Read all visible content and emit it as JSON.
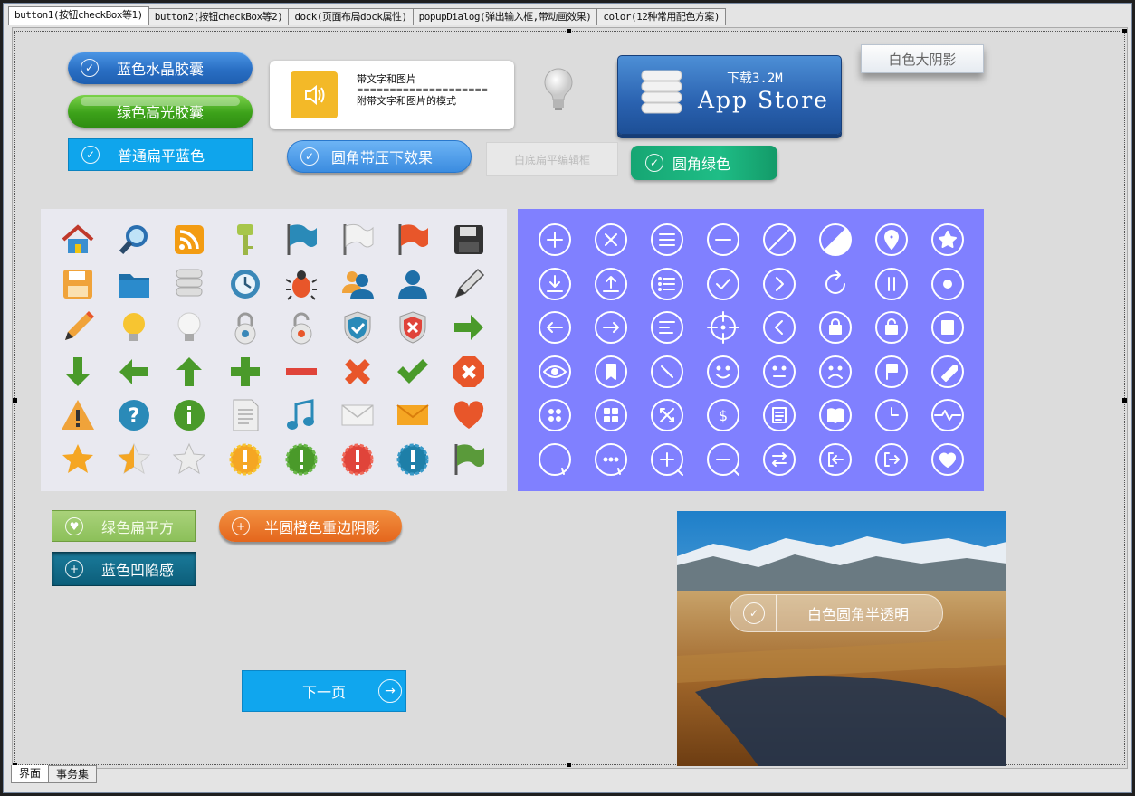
{
  "tabs": [
    {
      "label": "button1(按钮checkBox等1)"
    },
    {
      "label": "button2(按钮checkBox等2)"
    },
    {
      "label": "dock(页面布局dock属性)"
    },
    {
      "label": "popupDialog(弹出输入框,带动画效果)"
    },
    {
      "label": "color(12种常用配色方案)"
    }
  ],
  "buttons": {
    "blue_crystal": "蓝色水晶胶囊",
    "green_glow": "绿色高光胶囊",
    "flat_blue": "普通扁平蓝色",
    "press": "圆角带压下效果",
    "white_edit": "白底扁平编辑框",
    "round_green": "圆角绿色",
    "white_shadow": "白色大阴影",
    "green_flat": "绿色扁平方",
    "orange_pill": "半圆橙色重边阴影",
    "blue_inset": "蓝色凹陷感",
    "next": "下一页",
    "transparent": "白色圆角半透明"
  },
  "card": {
    "line1": "带文字和图片",
    "line2": "====================",
    "line3": "附带文字和图片的模式"
  },
  "appstore": {
    "sub": "下载3.2M",
    "main": "App Store"
  },
  "bottom_tabs": [
    {
      "label": "界面"
    },
    {
      "label": "事务集"
    }
  ],
  "colors": {
    "accent_blue": "#0fa5ec",
    "panel_purple": "#8080ff",
    "green": "#1fbd86"
  },
  "color_icons": [
    "home-icon",
    "search-icon",
    "rss-icon",
    "key-icon",
    "flag-blue-icon",
    "flag-white-icon",
    "flag-orange-icon",
    "floppy-black-icon",
    "floppy-orange-icon",
    "folder-icon",
    "database-icon",
    "clock-icon",
    "bug-icon",
    "users-icon",
    "user-icon",
    "pen-icon",
    "pencil-icon",
    "bulb-on-icon",
    "bulb-off-icon",
    "lock-icon",
    "unlock-icon",
    "shield-check-icon",
    "shield-x-icon",
    "arrow-right-icon",
    "arrow-down-icon",
    "arrow-left-icon",
    "arrow-up-icon",
    "plus-icon",
    "minus-icon",
    "x-icon",
    "check-icon",
    "stop-x-icon",
    "warning-icon",
    "help-icon",
    "info-icon",
    "document-icon",
    "music-icon",
    "mail-icon",
    "mail-orange-icon",
    "heart-icon",
    "star-full-icon",
    "star-half-icon",
    "star-empty-icon",
    "badge-yellow-icon",
    "badge-green-icon",
    "badge-red-icon",
    "badge-blue-icon",
    "flag-green-icon"
  ],
  "line_icons": [
    "plus-circle-icon",
    "x-circle-icon",
    "menu-circle-icon",
    "minus-circle-icon",
    "slash-circle-icon",
    "contrast-icon",
    "pin-icon",
    "star-circle-icon",
    "download-icon",
    "upload-icon",
    "list-icon",
    "check-circle-icon",
    "chevron-right-circle-icon",
    "refresh-icon",
    "pause-icon",
    "record-icon",
    "arrow-left-circle-icon",
    "arrow-right-circle-icon",
    "align-left-icon",
    "crosshair-icon",
    "chevron-left-circle-icon",
    "lock-circle-icon",
    "unlock-circle-icon",
    "card-circle-icon",
    "eye-icon",
    "bookmark-icon",
    "pencil-circle-icon",
    "smile-icon",
    "neutral-icon",
    "sad-icon",
    "flag-circle-icon",
    "tag-icon",
    "grid-dots-icon",
    "grid-icon",
    "expand-icon",
    "dollar-icon",
    "note-icon",
    "book-icon",
    "clock-circle-icon",
    "pulse-icon",
    "chat-icon",
    "chat-dots-icon",
    "zoom-in-icon",
    "zoom-out-icon",
    "swap-icon",
    "login-icon",
    "logout-icon",
    "heart-circle-icon"
  ]
}
